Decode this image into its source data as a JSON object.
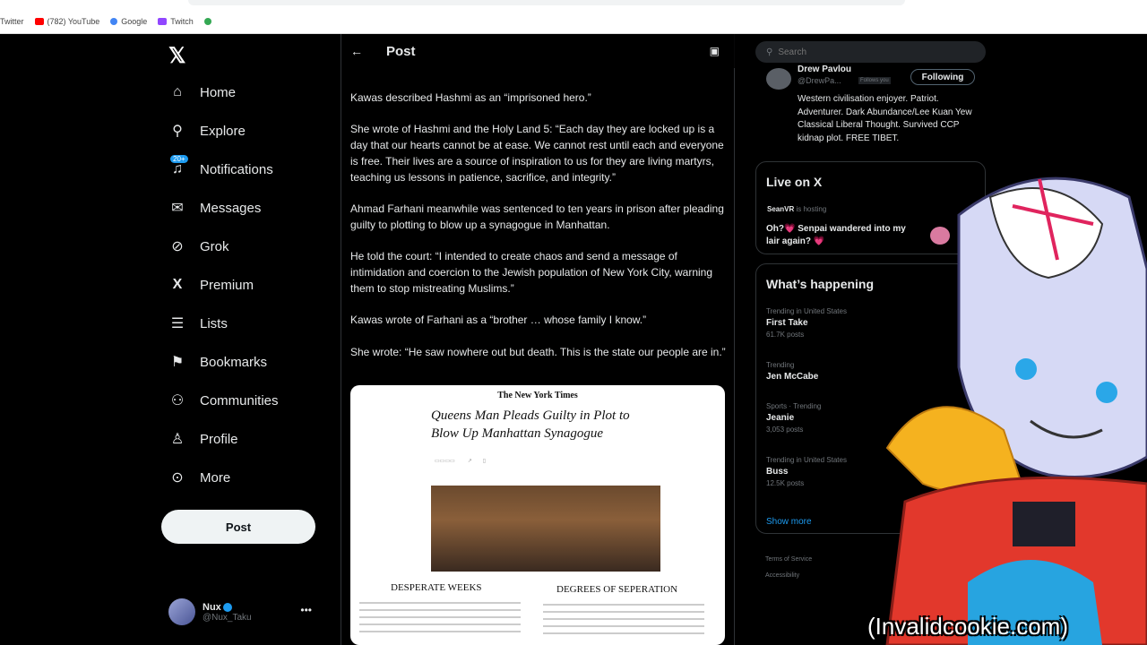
{
  "browser": {
    "bookmarks": [
      {
        "label": "Twitter",
        "color": "#1d9bf0",
        "icon": "twitter-icon"
      },
      {
        "label": "(782) YouTube",
        "color": "#ff0000",
        "icon": "youtube-icon"
      },
      {
        "label": "Google",
        "color": "#4285f4",
        "icon": "google-icon"
      },
      {
        "label": "Twitch",
        "color": "#9146ff",
        "icon": "twitch-icon"
      }
    ]
  },
  "sidebar": {
    "logo": "𝕏",
    "notifications_badge": "20+",
    "items": [
      {
        "label": "Home",
        "icon": "home-icon",
        "glyph": "⌂"
      },
      {
        "label": "Explore",
        "icon": "search-icon",
        "glyph": "⚲"
      },
      {
        "label": "Notifications",
        "icon": "bell-icon",
        "glyph": "🔔"
      },
      {
        "label": "Messages",
        "icon": "envelope-icon",
        "glyph": "✉"
      },
      {
        "label": "Grok",
        "icon": "grok-icon",
        "glyph": "⊘"
      },
      {
        "label": "Premium",
        "icon": "x-premium-icon",
        "glyph": "𝕏"
      },
      {
        "label": "Lists",
        "icon": "list-icon",
        "glyph": "☰"
      },
      {
        "label": "Bookmarks",
        "icon": "bookmark-icon",
        "glyph": "⚑"
      },
      {
        "label": "Communities",
        "icon": "communities-icon",
        "glyph": "👥"
      },
      {
        "label": "Profile",
        "icon": "person-icon",
        "glyph": "👤"
      },
      {
        "label": "More",
        "icon": "more-circle-icon",
        "glyph": "⊙"
      }
    ],
    "post_button": "Post",
    "account": {
      "name": "Nux",
      "handle": "@Nux_Taku"
    }
  },
  "main": {
    "title": "Post",
    "paragraphs": [
      "Kawas described Hashmi as an “imprisoned hero.”",
      "She wrote of Hashmi and the Holy Land 5: “Each day they are locked up is a day that our hearts cannot be at ease. We cannot rest until each and everyone is free. Their lives are a source of inspiration to us for they are living martyrs, teaching us lessons in patience, sacrifice, and integrity.”",
      "Ahmad Farhani meanwhile was sentenced to ten years in prison after pleading guilty to plotting to blow up a synagogue in Manhattan.",
      "He told the court: “I intended to create chaos and send a message of intimidation and coercion to the Jewish population of New York City, warning them to stop mistreating Muslims.”",
      "Kawas wrote of Farhani as a “brother … whose family I know.”",
      "She wrote: “He saw nowhere out but death. This is the state our people are in.”"
    ],
    "article": {
      "masthead": "The New York Times",
      "headline": "Queens Man Pleads Guilty in Plot to Blow Up Manhattan Synagogue",
      "subheads": [
        "DESPERATE WEEKS",
        "DEGREES OF SEPERATION"
      ]
    }
  },
  "right": {
    "search_placeholder": "Search",
    "user_card": {
      "name": "Drew Pavlou",
      "handle": "@DrewPa...",
      "follows_you": "Follows you",
      "following_button": "Following",
      "bio": "Western civilisation enjoyer. Patriot. Adventurer. Dark Abundance/Lee Kuan Yew Classical Liberal Thought. Survived CCP kidnap plot. FREE TIBET."
    },
    "live": {
      "title": "Live on X",
      "host": "SeanVR",
      "host_suffix": "is hosting",
      "stream_title": "Oh?💗 Senpai wandered into my lair again? 💗"
    },
    "trending": {
      "title": "What’s happening",
      "items": [
        {
          "context": "Trending in United States",
          "name": "First Take",
          "count": "61.7K posts"
        },
        {
          "context": "Trending",
          "name": "Jen McCabe",
          "count": ""
        },
        {
          "context": "Sports · Trending",
          "name": "Jeanie",
          "count": "3,053 posts"
        },
        {
          "context": "Trending in United States",
          "name": "Buss",
          "count": "12.5K posts"
        }
      ],
      "show_more": "Show more"
    },
    "footer": [
      "Terms of Service",
      "Accessibility"
    ]
  },
  "watermark": "(Invalidcookie.com)",
  "colors": {
    "accent": "#1d9bf0",
    "background": "#000000",
    "text": "#e7e9ea",
    "muted": "#71767b"
  }
}
